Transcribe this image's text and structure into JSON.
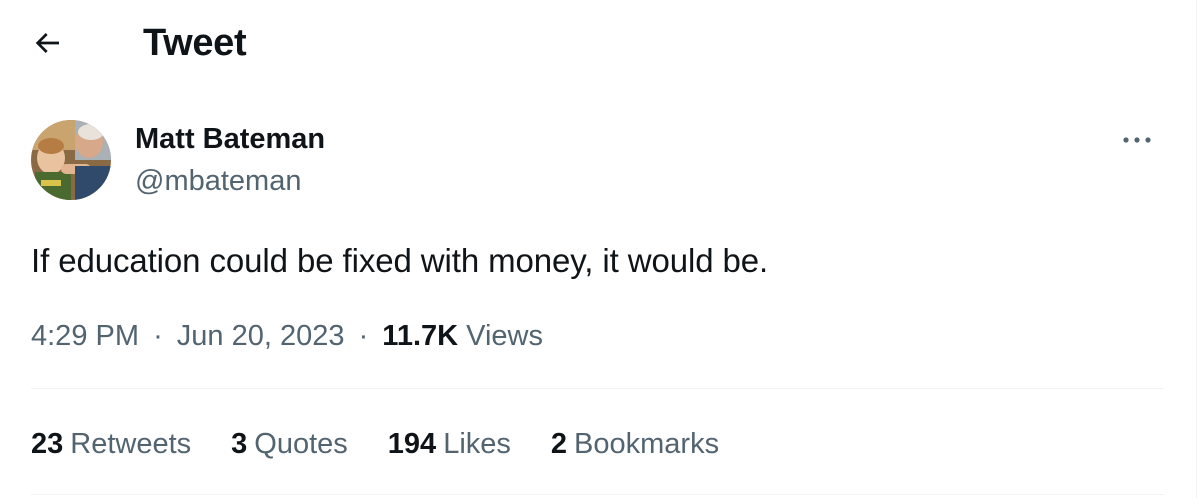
{
  "header": {
    "title": "Tweet",
    "back_icon": "arrow-left-icon"
  },
  "author": {
    "name": "Matt Bateman",
    "handle": "@mbateman",
    "more_icon": "more-horizontal-icon"
  },
  "tweet": {
    "text": "If education could be fixed with money, it would be."
  },
  "meta": {
    "time": "4:29 PM",
    "separator": "·",
    "date": "Jun 20, 2023",
    "views_count": "11.7K",
    "views_label": "Views"
  },
  "stats": [
    {
      "count": "23",
      "label": "Retweets"
    },
    {
      "count": "3",
      "label": "Quotes"
    },
    {
      "count": "194",
      "label": "Likes"
    },
    {
      "count": "2",
      "label": "Bookmarks"
    }
  ],
  "colors": {
    "primary_text": "#0f1419",
    "secondary_text": "#536471",
    "divider": "#eff3f4"
  }
}
